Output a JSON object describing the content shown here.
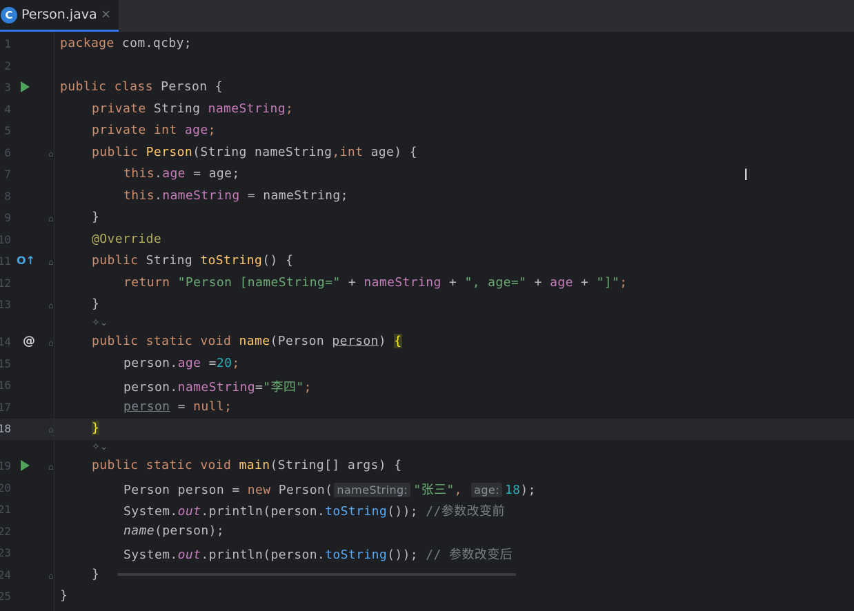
{
  "tab": {
    "icon": "java-class-icon",
    "icon_letter": "C",
    "label": "Person.java",
    "close": "×"
  },
  "editor": {
    "line_numbers": [
      "1",
      "2",
      "3",
      "4",
      "5",
      "6",
      "7",
      "8",
      "9",
      "10",
      "11",
      "12",
      "13",
      "14",
      "15",
      "16",
      "17",
      "18",
      "19",
      "20",
      "21",
      "22",
      "23",
      "24",
      "25"
    ],
    "current_line": "18",
    "lines": {
      "l1_kw": "package",
      "l1_rest": " com.qcby;",
      "l3_kw": "public class",
      "l3_rest": " Person {",
      "l4_kw": "private",
      "l4_type": " String ",
      "l4_field": "nameString",
      "l4_end": ";",
      "l5_kw": "private int",
      "l5_sp": " ",
      "l5_field": "age",
      "l5_end": ";",
      "l6_kw": "public",
      "l6_sp": " ",
      "l6_fn": "Person",
      "l6_rest1": "(String nameString",
      "l6_comma": ",",
      "l6_kw2": "int",
      "l6_rest2": " age) {",
      "l7_kw": "this",
      "l7_dot": ".",
      "l7_field": "age",
      "l7_rest": " = age;",
      "l8_kw": "this",
      "l8_dot": ".",
      "l8_field": "nameString",
      "l8_rest": " = nameString;",
      "l9": "}",
      "l10_ann": "@Override",
      "l11_kw": "public",
      "l11_type": " String ",
      "l11_fn": "toString",
      "l11_rest": "() {",
      "l12_kw": "return",
      "l12_sp": " ",
      "l12_s1": "\"Person [nameString=\"",
      "l12_p1": " + ",
      "l12_f1": "nameString",
      "l12_p2": " + ",
      "l12_s2": "\", age=\"",
      "l12_p3": " + ",
      "l12_f2": "age",
      "l12_p4": " + ",
      "l12_s3": "\"]\"",
      "l12_end": ";",
      "l13": "}",
      "l14_kw": "public static void",
      "l14_sp": " ",
      "l14_fn": "name",
      "l14_rest1": "(Person ",
      "l14_param": "person",
      "l14_rest2": ") ",
      "l14_brace": "{",
      "l15_var": "person.",
      "l15_field": "age",
      "l15_op": " =",
      "l15_num": "20",
      "l15_end": ";",
      "l16_var": "person.",
      "l16_field": "nameString",
      "l16_op": "=",
      "l16_str": "\"李四\"",
      "l16_end": ";",
      "l17_var": "person",
      "l17_rest": " = ",
      "l17_kw": "null",
      "l17_end": ";",
      "l18_brace": "}",
      "l19_kw": "public static void",
      "l19_sp": " ",
      "l19_fn": "main",
      "l19_rest": "(String[] args) {",
      "l20_type": "Person person = ",
      "l20_kw": "new",
      "l20_rest1": " Person(",
      "l20_hint1": "nameString:",
      "l20_str": "\"张三\"",
      "l20_comma": ", ",
      "l20_hint2": "age:",
      "l20_num": "18",
      "l20_end": ");",
      "l21_a": "System.",
      "l21_out": "out",
      "l21_b": ".println(person.",
      "l21_fn": "toString",
      "l21_c": "()); ",
      "l21_cmt": "//参数改变前",
      "l22_fn": "name",
      "l22_rest": "(person);",
      "l23_a": "System.",
      "l23_out": "out",
      "l23_b": ".println(person.",
      "l23_fn": "toString",
      "l23_c": "()); ",
      "l23_cmt": "// 参数改变后",
      "l24": "}",
      "l25": "}"
    },
    "gutter": {
      "override_glyph": "O↑",
      "at_glyph": "@",
      "ai_hint": "✧⌄"
    },
    "cursor_glyph": "I"
  }
}
